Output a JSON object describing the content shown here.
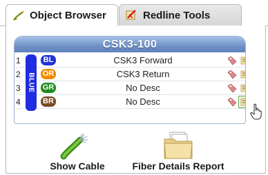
{
  "tabs": [
    {
      "label": "Object Browser",
      "active": true
    },
    {
      "label": "Redline Tools",
      "active": false
    }
  ],
  "cable": {
    "title": "CSK3-100",
    "group_label": "BLUE",
    "rows": [
      {
        "num": "1",
        "badge": "BL",
        "badge_color": "#2133d6",
        "desc": "CSK3 Forward"
      },
      {
        "num": "2",
        "badge": "OR",
        "badge_color": "#f28c00",
        "desc": "CSK3 Return"
      },
      {
        "num": "3",
        "badge": "GR",
        "badge_color": "#1e8c1e",
        "desc": "No Desc"
      },
      {
        "num": "4",
        "badge": "BR",
        "badge_color": "#7a4a26",
        "desc": "No Desc"
      }
    ]
  },
  "actions": {
    "show_cable": "Show Cable",
    "fiber_report": "Fiber Details Report"
  },
  "icons": {
    "tab_object": "object-browser-icon",
    "tab_redline": "redline-tools-icon",
    "row_tag": "tag-icon",
    "row_edit": "edit-details-icon",
    "show_cable": "fiber-cable-icon",
    "report": "folder-report-icon",
    "cursor": "hand-pointer-icon"
  }
}
